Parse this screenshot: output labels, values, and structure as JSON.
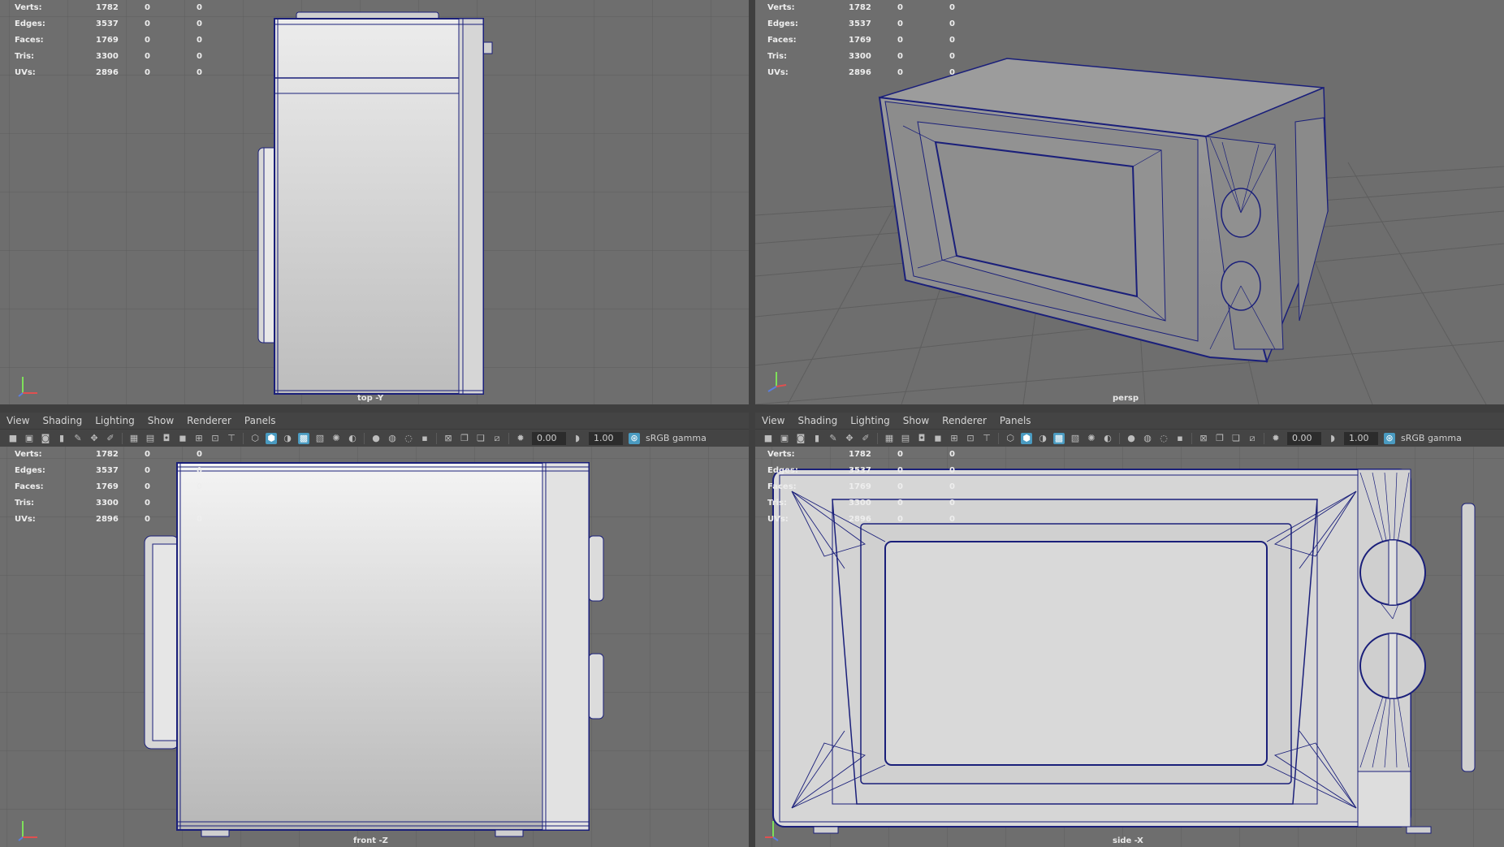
{
  "stats": [
    {
      "label": "Verts:",
      "v1": "1782",
      "v2": "0",
      "v3": "0"
    },
    {
      "label": "Edges:",
      "v1": "3537",
      "v2": "0",
      "v3": "0"
    },
    {
      "label": "Faces:",
      "v1": "1769",
      "v2": "0",
      "v3": "0"
    },
    {
      "label": "Tris:",
      "v1": "3300",
      "v2": "0",
      "v3": "0"
    },
    {
      "label": "UVs:",
      "v1": "2896",
      "v2": "0",
      "v3": "0"
    }
  ],
  "viewports": {
    "top": {
      "label": "top -Y"
    },
    "persp": {
      "label": "persp"
    },
    "front": {
      "label": "front -Z"
    },
    "side": {
      "label": "side -X"
    }
  },
  "menu": [
    "View",
    "Shading",
    "Lighting",
    "Show",
    "Renderer",
    "Panels"
  ],
  "toolbar": {
    "field1": "0.00",
    "field2": "1.00",
    "color_space": "sRGB gamma"
  },
  "colors": {
    "wire": "#1a1f7a",
    "viewport_bg": "#6e6e6e",
    "panel_bg": "#444444",
    "accent": "#4a9bc1"
  }
}
